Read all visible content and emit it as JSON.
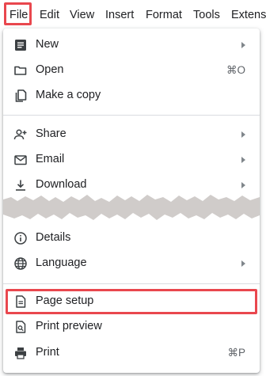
{
  "menubar": {
    "items": [
      {
        "label": "File"
      },
      {
        "label": "Edit"
      },
      {
        "label": "View"
      },
      {
        "label": "Insert"
      },
      {
        "label": "Format"
      },
      {
        "label": "Tools"
      },
      {
        "label": "Extens"
      }
    ]
  },
  "file_menu": {
    "items": [
      {
        "label": "New",
        "icon": "document-icon",
        "has_submenu": true
      },
      {
        "label": "Open",
        "icon": "folder-icon",
        "shortcut": "⌘O"
      },
      {
        "label": "Make a copy",
        "icon": "copy-icon"
      },
      {
        "label": "Share",
        "icon": "person-add-icon",
        "has_submenu": true
      },
      {
        "label": "Email",
        "icon": "email-icon",
        "has_submenu": true
      },
      {
        "label": "Download",
        "icon": "download-icon",
        "has_submenu": true
      },
      {
        "label": "Details",
        "icon": "info-icon"
      },
      {
        "label": "Language",
        "icon": "globe-icon",
        "has_submenu": true
      },
      {
        "label": "Page setup",
        "icon": "page-icon",
        "highlighted": true
      },
      {
        "label": "Print preview",
        "icon": "preview-icon"
      },
      {
        "label": "Print",
        "icon": "printer-icon",
        "shortcut": "⌘P"
      }
    ]
  },
  "colors": {
    "highlight_border": "#e9474e",
    "separator": "#dadce0",
    "text": "#202124",
    "icon": "#3c4043",
    "torn_edge": "#d0ccca"
  }
}
